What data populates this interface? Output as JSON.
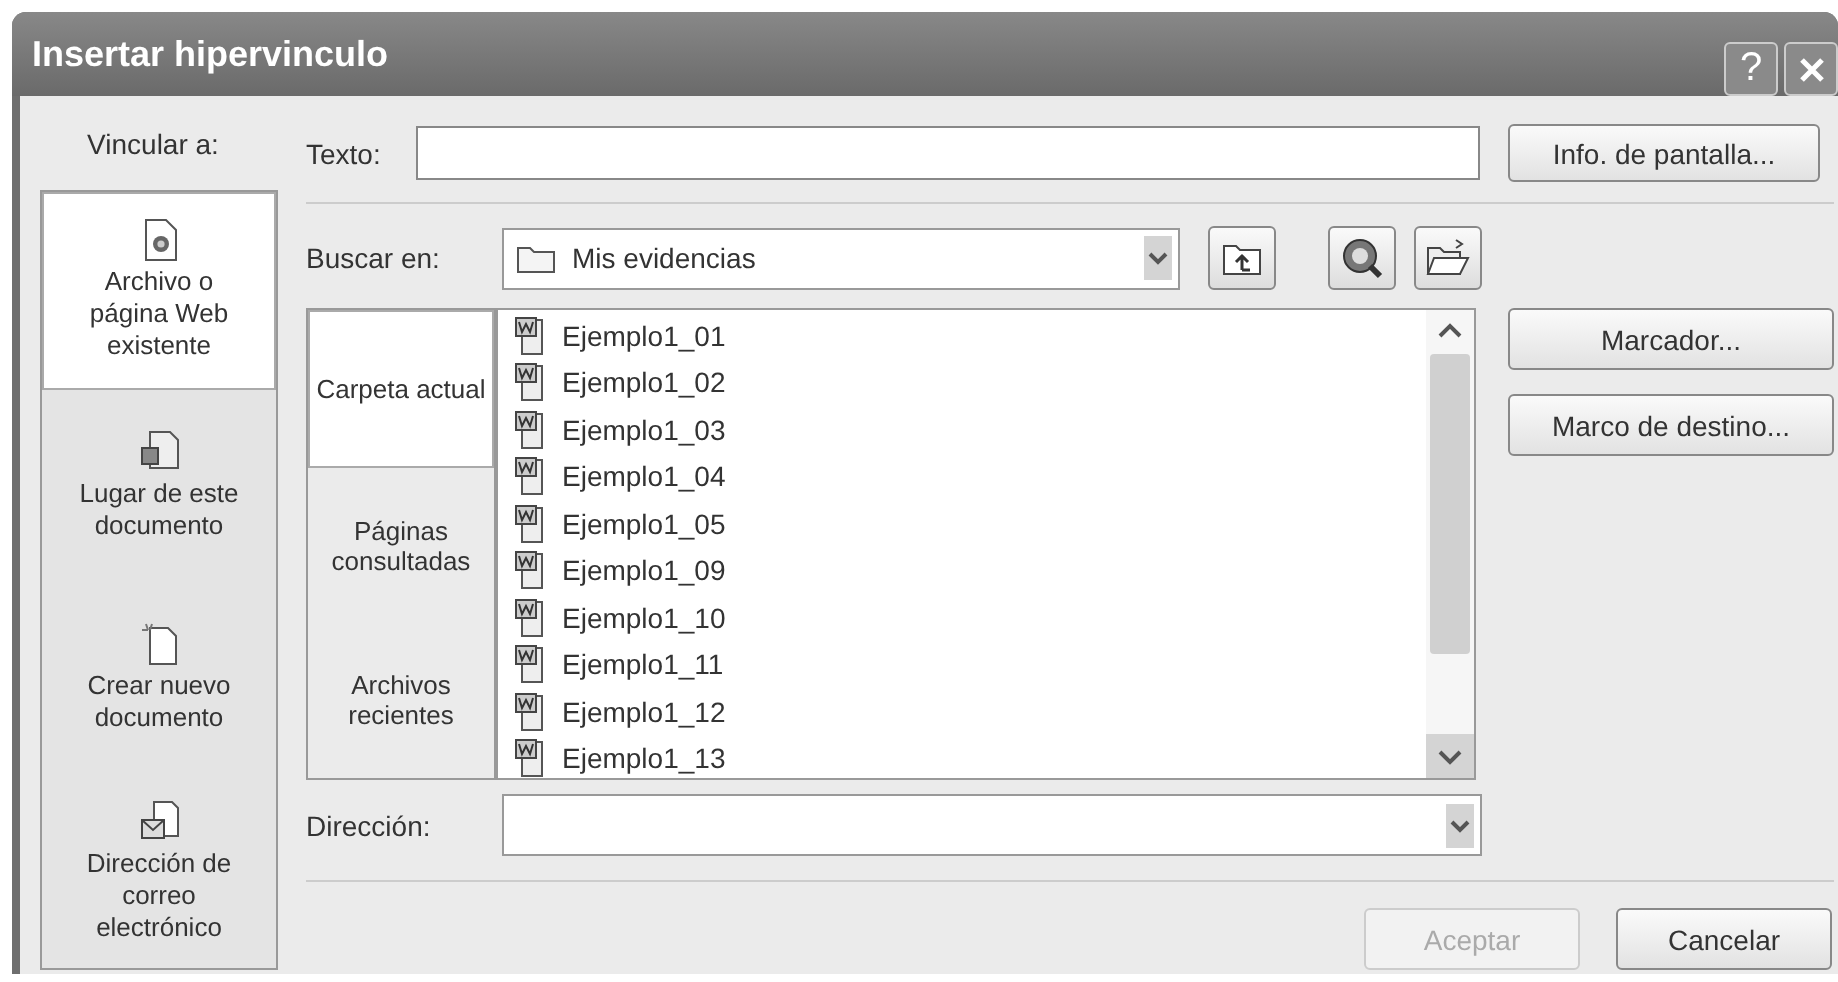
{
  "window": {
    "title": "Insertar hipervinculo",
    "help_button": "?"
  },
  "link_to": {
    "label": "Vincular a:",
    "items": [
      {
        "label": "Archivo o página Web existente",
        "kind": "file",
        "selected": true
      },
      {
        "label": "Lugar de este documento",
        "kind": "place",
        "selected": false
      },
      {
        "label": "Crear nuevo documento",
        "kind": "new",
        "selected": false
      },
      {
        "label": "Dirección de correo electrónico",
        "kind": "email",
        "selected": false
      }
    ]
  },
  "text_field": {
    "label": "Texto:"
  },
  "screen_tip_button": "Info. de pantalla...",
  "look_in": {
    "label": "Buscar en:",
    "value": "Mis evidencias"
  },
  "views": [
    {
      "label": "Carpeta actual",
      "selected": true
    },
    {
      "label": "Páginas consultadas",
      "selected": false
    },
    {
      "label": "Archivos recientes",
      "selected": false
    }
  ],
  "files": [
    "Ejemplo1_01",
    "Ejemplo1_02",
    "Ejemplo1_03",
    "Ejemplo1_04",
    "Ejemplo1_05",
    "Ejemplo1_09",
    "Ejemplo1_10",
    "Ejemplo1_11",
    "Ejemplo1_12",
    "Ejemplo1_13"
  ],
  "side_buttons": [
    "Marcador...",
    "Marco de destino..."
  ],
  "address": {
    "label": "Dirección:"
  },
  "footer_buttons": [
    {
      "label": "Aceptar",
      "disabled": true
    },
    {
      "label": "Cancelar",
      "disabled": false
    }
  ]
}
